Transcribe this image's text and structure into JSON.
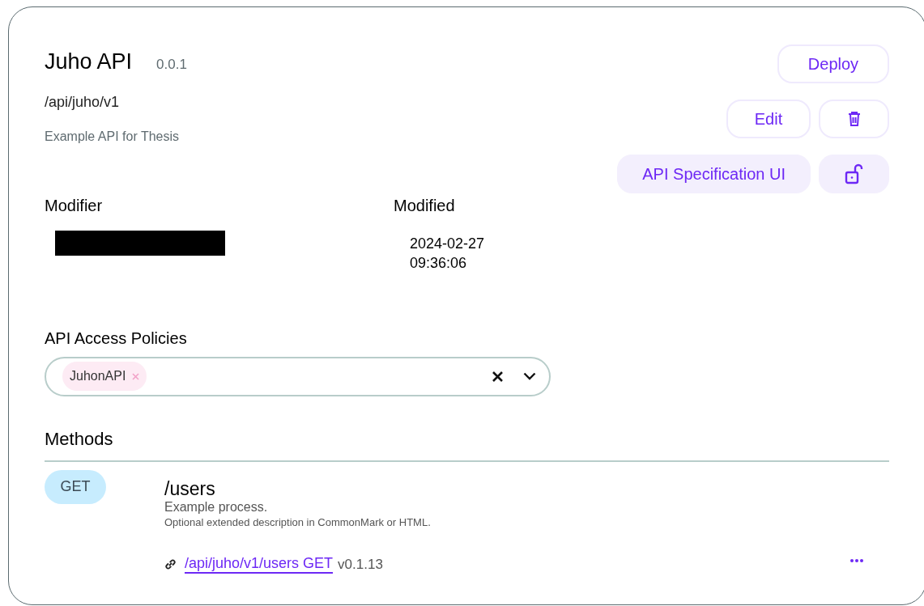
{
  "api": {
    "name": "Juho API",
    "version": "0.0.1",
    "base_path": "/api/juho/v1",
    "description": "Example API for Thesis"
  },
  "action_rows": [
    [
      {
        "kind": "outline",
        "label": "Deploy"
      }
    ],
    [
      {
        "kind": "outline",
        "label": "Edit"
      },
      {
        "kind": "trash"
      }
    ],
    [
      {
        "kind": "filled",
        "label": "API Specification UI"
      },
      {
        "kind": "padlock"
      }
    ]
  ],
  "meta": [
    {
      "label": "Modifier",
      "redacted": true
    },
    {
      "label": "Modified",
      "value": "2024-02-27 09:36:06"
    }
  ],
  "access_policies": {
    "label": "API Access Policies",
    "tags": [
      {
        "label": "JuhonAPI"
      }
    ]
  },
  "methods": {
    "title": "Methods",
    "items": [
      {
        "verb": "GET",
        "path": "/users",
        "summary": "Example process.",
        "description": "Optional extended description in CommonMark or HTML.",
        "link": "/api/juho/v1/users GET",
        "version": "v0.1.13"
      }
    ]
  }
}
